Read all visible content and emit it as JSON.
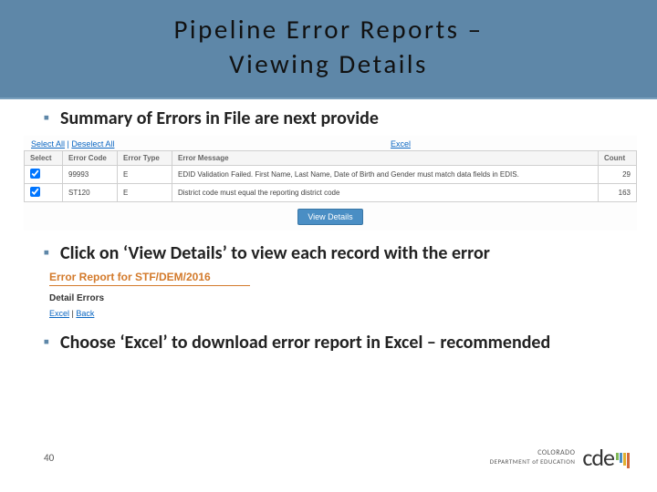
{
  "title": {
    "line1": "Pipeline Error Reports –",
    "line2": "Viewing Details"
  },
  "bullets": {
    "b1": "Summary of Errors in File are next provide",
    "b2": "Click on ‘View Details’ to view each record with the error",
    "b3": "Choose ‘Excel’ to download error report in Excel – recommended"
  },
  "shot1": {
    "select_all": "Select All",
    "deselect_all": "Deselect All",
    "excel": "Excel",
    "headers": {
      "select": "Select",
      "code": "Error Code",
      "type": "Error Type",
      "msg": "Error Message",
      "count": "Count"
    },
    "rows": [
      {
        "code": "99993",
        "type": "E",
        "msg": "EDID Validation Failed. First Name, Last Name, Date of Birth and Gender must match data fields in EDIS.",
        "count": "29"
      },
      {
        "code": "ST120",
        "type": "E",
        "msg": "District code must equal the reporting district code",
        "count": "163"
      }
    ],
    "view_details": "View Details"
  },
  "shot2": {
    "heading": "Error Report for STF/DEM/2016",
    "sub": "Detail Errors",
    "excel": "Excel",
    "back": "Back"
  },
  "footer": {
    "page": "40",
    "brand_line1": "COLORADO",
    "brand_line2": "DEPARTMENT of EDUCATION",
    "mark": "cde"
  }
}
